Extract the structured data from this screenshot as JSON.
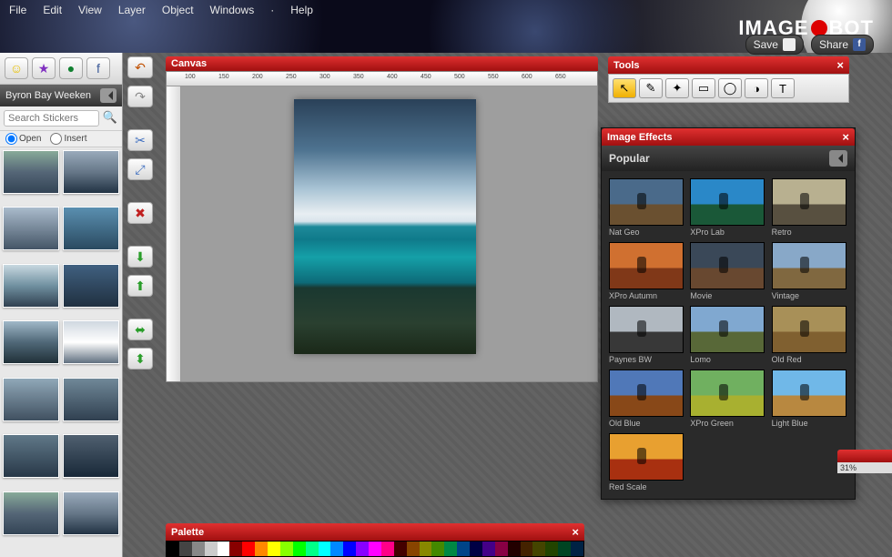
{
  "brand": {
    "part1": "IMAGE",
    "part2": "BOT"
  },
  "menu": [
    "File",
    "Edit",
    "View",
    "Layer",
    "Object",
    "Windows",
    "·",
    "Help"
  ],
  "topButtons": {
    "save": "Save",
    "share": "Share"
  },
  "sidebar": {
    "socialIcons": [
      "smiley",
      "star",
      "badge",
      "facebook"
    ],
    "albumTitle": "Byron Bay Weeken",
    "searchPlaceholder": "Search Stickers",
    "radios": {
      "open": "Open",
      "insert": "Insert",
      "selected": "open"
    },
    "thumbs": 14
  },
  "vtools": [
    {
      "name": "undo",
      "glyph": "↶",
      "color": "#c05000"
    },
    {
      "name": "redo",
      "glyph": "↷",
      "color": "#888"
    },
    {
      "type": "gap"
    },
    {
      "name": "crop",
      "glyph": "✂",
      "color": "#4070c0"
    },
    {
      "name": "resize",
      "glyph": "⤢",
      "color": "#4070c0"
    },
    {
      "type": "gap"
    },
    {
      "name": "delete",
      "glyph": "✖",
      "color": "#c02020"
    },
    {
      "type": "gap"
    },
    {
      "name": "flip-v",
      "glyph": "⬇",
      "color": "#2a9d2a"
    },
    {
      "name": "flip-h",
      "glyph": "⬆",
      "color": "#2a9d2a"
    },
    {
      "type": "gap"
    },
    {
      "name": "move-h",
      "glyph": "⬌",
      "color": "#2a9d2a"
    },
    {
      "name": "move-v",
      "glyph": "⬍",
      "color": "#2a9d2a"
    }
  ],
  "canvas": {
    "title": "Canvas",
    "rulerMarks": [
      100,
      150,
      200,
      250,
      300,
      350,
      400,
      450,
      500,
      550,
      600,
      650
    ]
  },
  "tools": {
    "title": "Tools",
    "items": [
      {
        "name": "pointer",
        "glyph": "↖",
        "selected": true
      },
      {
        "name": "brush",
        "glyph": "✎"
      },
      {
        "name": "wand",
        "glyph": "✦"
      },
      {
        "name": "rect",
        "glyph": "▭"
      },
      {
        "name": "ellipse",
        "glyph": "◯"
      },
      {
        "name": "shape",
        "glyph": "◑"
      },
      {
        "name": "text",
        "glyph": "T"
      }
    ]
  },
  "effects": {
    "title": "Image Effects",
    "category": "Popular",
    "items": [
      {
        "label": "Nat Geo",
        "sky": "#4a6a8a",
        "gnd": "#6a5030"
      },
      {
        "label": "XPro Lab",
        "sky": "#2a88c8",
        "gnd": "#1a5838"
      },
      {
        "label": "Retro",
        "sky": "#b8b090",
        "gnd": "#585040"
      },
      {
        "label": "XPro Autumn",
        "sky": "#d07030",
        "gnd": "#803818"
      },
      {
        "label": "Movie",
        "sky": "#3a4858",
        "gnd": "#684830"
      },
      {
        "label": "Vintage",
        "sky": "#88a8c8",
        "gnd": "#806840"
      },
      {
        "label": "Paynes BW",
        "sky": "#b0b8c0",
        "gnd": "#383838"
      },
      {
        "label": "Lomo",
        "sky": "#80a8d0",
        "gnd": "#586838"
      },
      {
        "label": "Old Red",
        "sky": "#a89058",
        "gnd": "#806030"
      },
      {
        "label": "Old Blue",
        "sky": "#5078b8",
        "gnd": "#884818"
      },
      {
        "label": "XPro Green",
        "sky": "#70b060",
        "gnd": "#a8b030"
      },
      {
        "label": "Light Blue",
        "sky": "#70b8e8",
        "gnd": "#b88840"
      },
      {
        "label": "Red Scale",
        "sky": "#e8a030",
        "gnd": "#a83010"
      }
    ]
  },
  "palette": {
    "title": "Palette",
    "swatches": [
      "#000",
      "#444",
      "#888",
      "#ccc",
      "#fff",
      "#800",
      "#f00",
      "#f80",
      "#ff0",
      "#8f0",
      "#0f0",
      "#0f8",
      "#0ff",
      "#08f",
      "#00f",
      "#80f",
      "#f0f",
      "#f08",
      "#400",
      "#840",
      "#880",
      "#480",
      "#084",
      "#048",
      "#004",
      "#408",
      "#804",
      "#200",
      "#420",
      "#440",
      "#240",
      "#042",
      "#024"
    ]
  },
  "status": {
    "zoom": "31%"
  }
}
